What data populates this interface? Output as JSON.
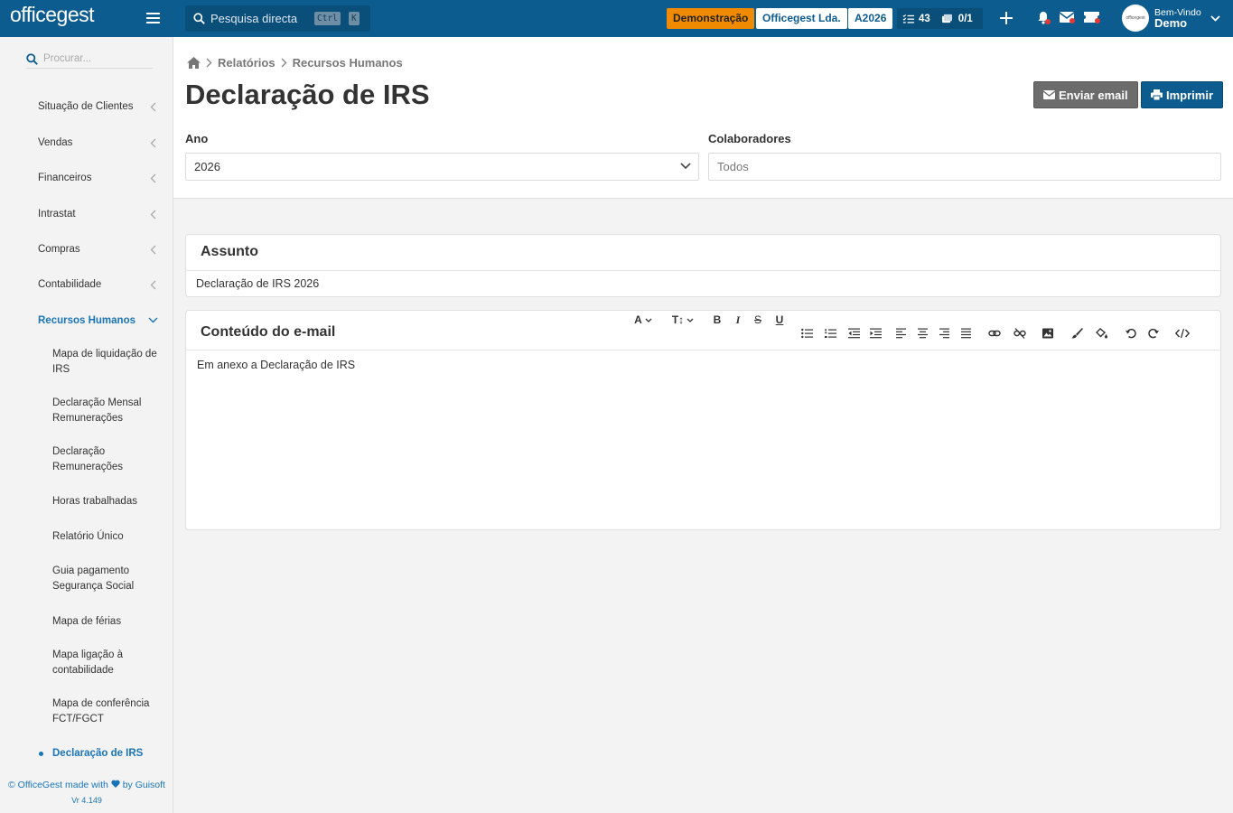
{
  "topbar": {
    "logo": "officegest",
    "search_label": "Pesquisa directa",
    "kbd_ctrl": "Ctrl",
    "kbd_k": "K",
    "demo_badge": "Demonstração",
    "company_badge": "Officegest Lda.",
    "year_badge": "A2026",
    "tasks_count": "43",
    "docs_count": "0/1",
    "welcome": "Bem-Vindo",
    "user_name": "Demo",
    "avatar_text": "officegest"
  },
  "sidebar": {
    "search_placeholder": "Procurar...",
    "menu": [
      {
        "label": "Situação de Clientes"
      },
      {
        "label": "Vendas"
      },
      {
        "label": "Financeiros"
      },
      {
        "label": "Intrastat"
      },
      {
        "label": "Compras"
      },
      {
        "label": "Contabilidade"
      },
      {
        "label": "Recursos Humanos"
      }
    ],
    "submenu": [
      {
        "label": "Mapa de liquidação de IRS"
      },
      {
        "label": "Declaração Mensal Remunerações"
      },
      {
        "label": "Declaração Remunerações"
      },
      {
        "label": "Horas trabalhadas"
      },
      {
        "label": "Relatório Único"
      },
      {
        "label": "Guia pagamento Segurança Social"
      },
      {
        "label": "Mapa de férias"
      },
      {
        "label": "Mapa ligação à contabilidade"
      },
      {
        "label": "Mapa de conferência FCT/FGCT"
      },
      {
        "label": "Declaração de IRS"
      }
    ],
    "footer_pre": "© OfficeGest made with",
    "footer_post": "by Guisoft",
    "version": "Vr 4.149"
  },
  "breadcrumb": [
    "Relatórios",
    "Recursos Humanos"
  ],
  "page": {
    "title": "Declaração de IRS",
    "email_button": "Enviar email",
    "print_button": "Imprimir",
    "ano_label": "Ano",
    "ano_value": "2026",
    "colab_label": "Colaboradores",
    "colab_placeholder": "Todos"
  },
  "assunto": {
    "title": "Assunto",
    "value": "Declaração de IRS 2026"
  },
  "email": {
    "title": "Conteúdo do e-mail",
    "body": "Em anexo a Declaração de IRS",
    "font_label": "A",
    "size_label": "T↕",
    "bold": "B",
    "italic": "I",
    "strike": "S",
    "underline": "U"
  },
  "colors": {
    "brand": "#0c5c8f",
    "accent": "#1a75b8",
    "demo": "#f08a00"
  }
}
